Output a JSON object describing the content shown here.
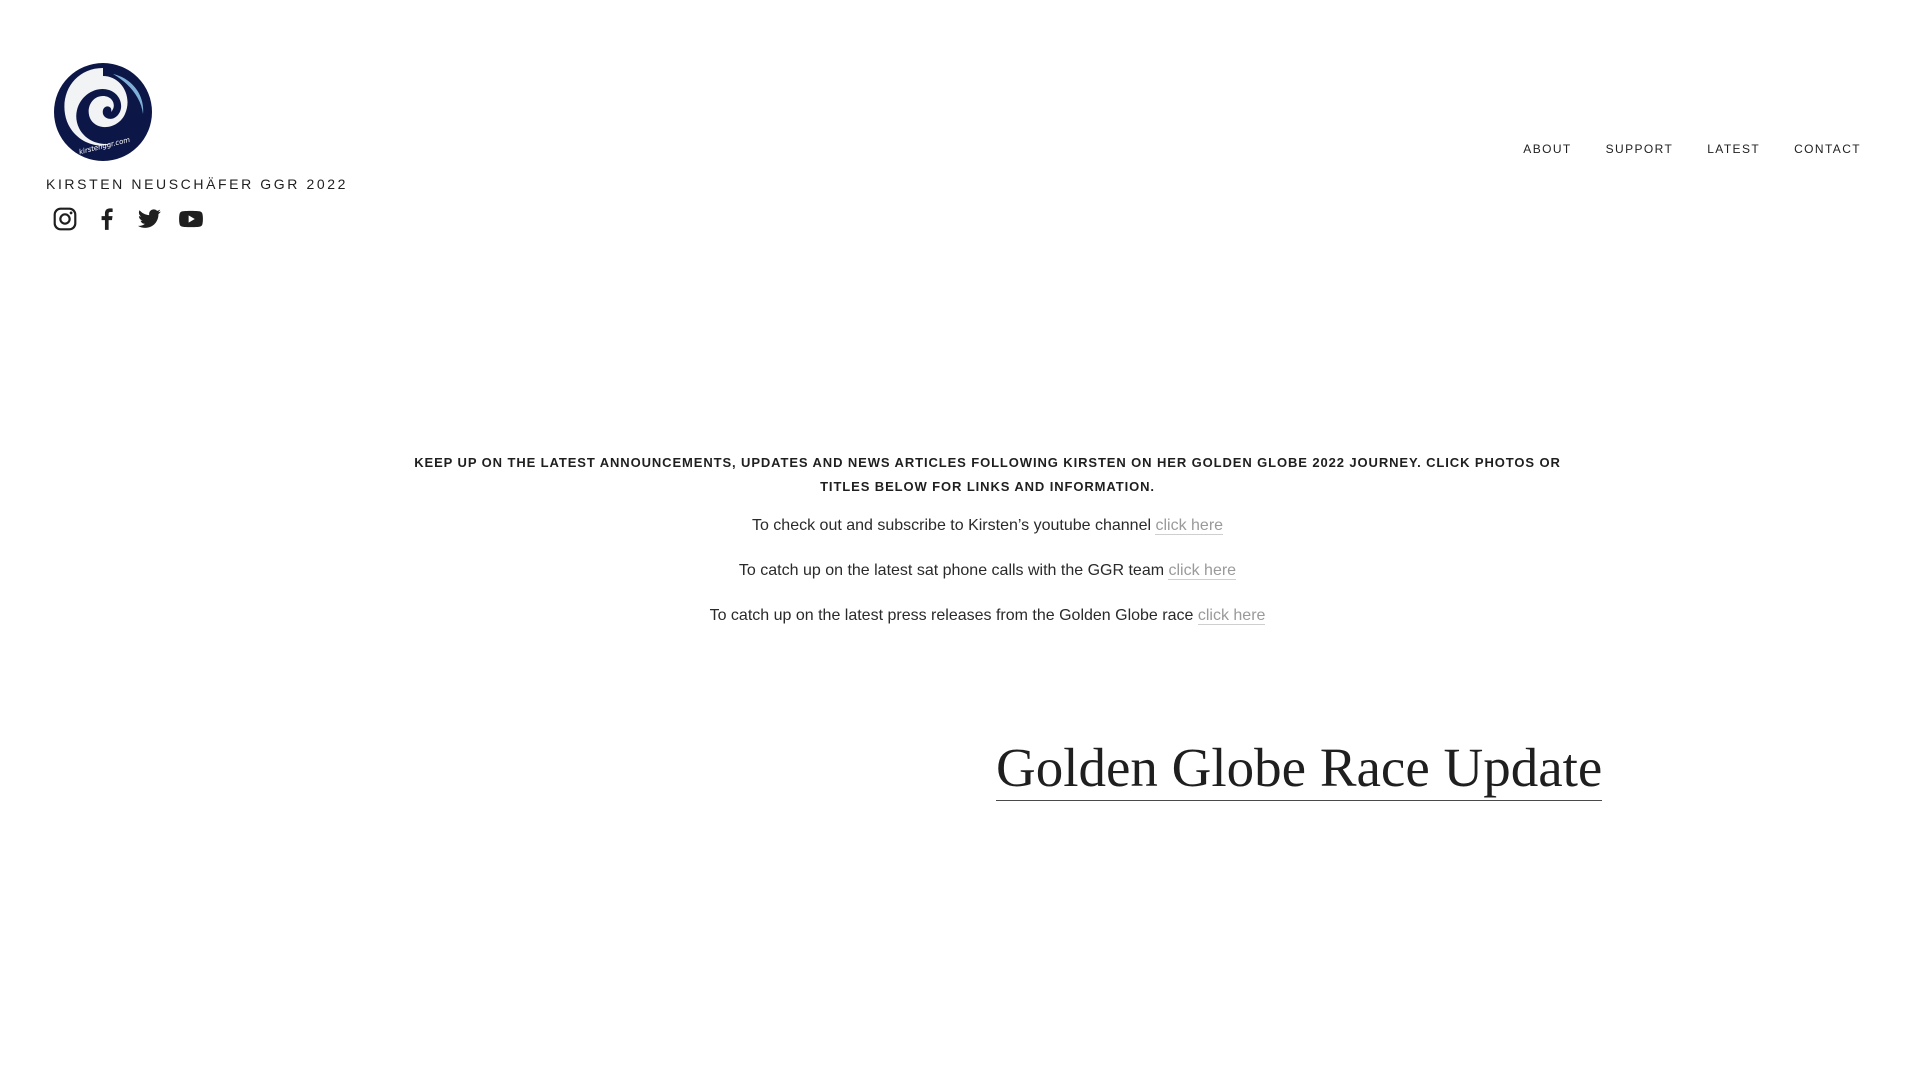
{
  "header": {
    "site_title": "KIRSTEN NEUSCHÄFER GGR 2022",
    "logo": {
      "name": "kirstenggr-logo",
      "text": "kirstenggr.com",
      "colors": {
        "primary": "#0d1747",
        "accent": "#ffffff"
      }
    },
    "social": [
      {
        "name": "instagram-icon"
      },
      {
        "name": "facebook-icon"
      },
      {
        "name": "twitter-icon"
      },
      {
        "name": "youtube-icon"
      }
    ],
    "nav": [
      {
        "label": "ABOUT"
      },
      {
        "label": "SUPPORT"
      },
      {
        "label": "LATEST"
      },
      {
        "label": "CONTACT"
      }
    ]
  },
  "main": {
    "intro": "KEEP UP ON THE LATEST ANNOUNCEMENTS, UPDATES AND NEWS ARTICLES FOLLOWING KIRSTEN ON HER GOLDEN GLOBE 2022 JOURNEY. CLICK PHOTOS OR TITLES BELOW FOR LINKS AND INFORMATION.",
    "links": [
      {
        "text": "To check out and subscribe to Kirsten’s youtube channel ",
        "link": "click here"
      },
      {
        "text": "To catch up on the latest sat phone calls with the GGR team ",
        "link": "click here"
      },
      {
        "text": "To catch up on the latest press releases from the Golden Globe race ",
        "link": "click here"
      }
    ],
    "post_title": "Golden Globe Race Update"
  },
  "colors": {
    "text": "#1f1f1f",
    "link": "#9a9a9a",
    "background": "#ffffff"
  }
}
